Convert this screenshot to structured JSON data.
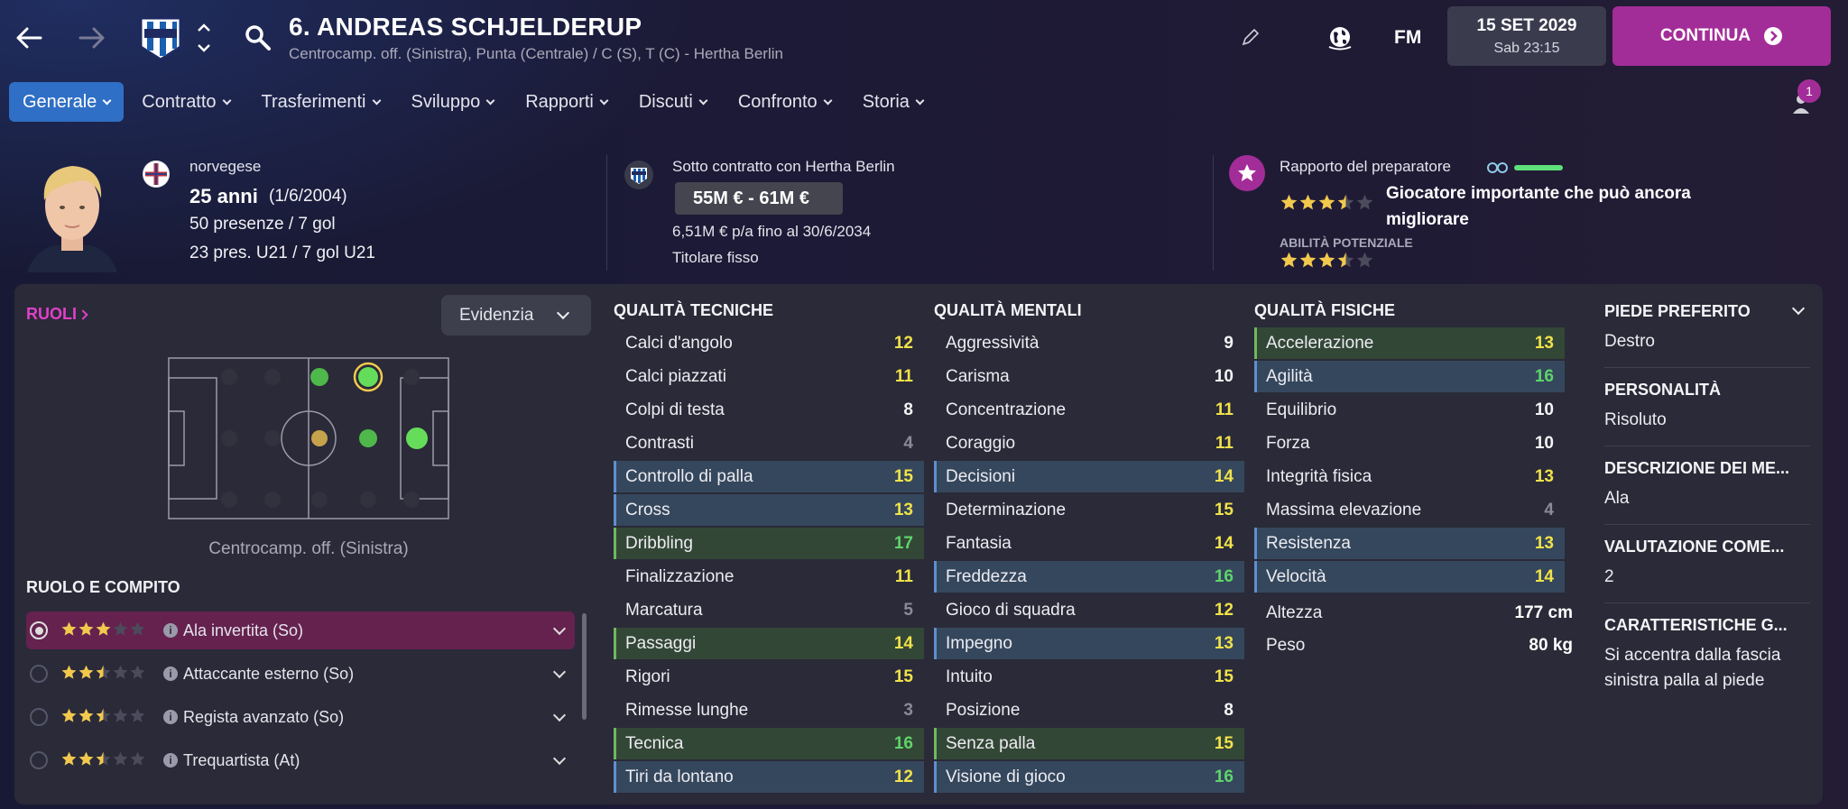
{
  "header": {
    "title": "6. ANDREAS SCHJELDERUP",
    "subtitle": "Centrocamp. off. (Sinistra), Punta (Centrale) / C (S), T (C) - Hertha Berlin",
    "date": "15 SET 2029",
    "time": "Sab 23:15",
    "continue_label": "CONTINUA",
    "fm_label": "FM"
  },
  "tabs": [
    "Generale",
    "Contratto",
    "Trasferimenti",
    "Sviluppo",
    "Rapporti",
    "Discuti",
    "Confronto",
    "Storia"
  ],
  "notification_count": "1",
  "player": {
    "nationality": "norvegese",
    "age": "25 anni",
    "birthdate": "(1/6/2004)",
    "apps": "50 presenze / 7 gol",
    "u21": "23 pres. U21 / 7 gol U21"
  },
  "contract": {
    "club": "Sotto contratto con Hertha Berlin",
    "value": "55M € - 61M €",
    "wage": "6,51M € p/a fino al 30/6/2034",
    "status": "Titolare fisso"
  },
  "coach_report": {
    "label": "Rapporto del preparatore",
    "summary_line1": "Giocatore importante che può ancora",
    "summary_line2": "migliorare",
    "potential_label": "ABILITÀ POTENZIALE",
    "current_stars": 3.5,
    "potential_stars": 3.5
  },
  "roles": {
    "title": "RUOLI",
    "highlight_button": "Evidenzia",
    "position_label": "Centrocamp. off. (Sinistra)",
    "role_duty_title": "RUOLO E COMPITO",
    "items": [
      {
        "label": "Ala invertita (So)",
        "stars": 3
      },
      {
        "label": "Attaccante esterno (So)",
        "stars": 2.5
      },
      {
        "label": "Regista avanzato (So)",
        "stars": 2.5
      },
      {
        "label": "Trequartista (At)",
        "stars": 2.5
      }
    ]
  },
  "technical": {
    "title": "QUALITÀ TECNICHE",
    "items": [
      {
        "name": "Calci d'angolo",
        "value": "12"
      },
      {
        "name": "Calci piazzati",
        "value": "11"
      },
      {
        "name": "Colpi di testa",
        "value": "8"
      },
      {
        "name": "Contrasti",
        "value": "4"
      },
      {
        "name": "Controllo di palla",
        "value": "15"
      },
      {
        "name": "Cross",
        "value": "13"
      },
      {
        "name": "Dribbling",
        "value": "17"
      },
      {
        "name": "Finalizzazione",
        "value": "11"
      },
      {
        "name": "Marcatura",
        "value": "5"
      },
      {
        "name": "Passaggi",
        "value": "14"
      },
      {
        "name": "Rigori",
        "value": "15"
      },
      {
        "name": "Rimesse lunghe",
        "value": "3"
      },
      {
        "name": "Tecnica",
        "value": "16"
      },
      {
        "name": "Tiri da lontano",
        "value": "12"
      }
    ]
  },
  "mental": {
    "title": "QUALITÀ MENTALI",
    "items": [
      {
        "name": "Aggressività",
        "value": "9"
      },
      {
        "name": "Carisma",
        "value": "10"
      },
      {
        "name": "Concentrazione",
        "value": "11"
      },
      {
        "name": "Coraggio",
        "value": "11"
      },
      {
        "name": "Decisioni",
        "value": "14"
      },
      {
        "name": "Determinazione",
        "value": "15"
      },
      {
        "name": "Fantasia",
        "value": "14"
      },
      {
        "name": "Freddezza",
        "value": "16"
      },
      {
        "name": "Gioco di squadra",
        "value": "12"
      },
      {
        "name": "Impegno",
        "value": "13"
      },
      {
        "name": "Intuito",
        "value": "15"
      },
      {
        "name": "Posizione",
        "value": "8"
      },
      {
        "name": "Senza palla",
        "value": "15"
      },
      {
        "name": "Visione di gioco",
        "value": "16"
      }
    ]
  },
  "physical": {
    "title": "QUALITÀ FISICHE",
    "items": [
      {
        "name": "Accelerazione",
        "value": "13"
      },
      {
        "name": "Agilità",
        "value": "16"
      },
      {
        "name": "Equilibrio",
        "value": "10"
      },
      {
        "name": "Forza",
        "value": "10"
      },
      {
        "name": "Integrità fisica",
        "value": "13"
      },
      {
        "name": "Massima elevazione",
        "value": "4"
      },
      {
        "name": "Resistenza",
        "value": "13"
      },
      {
        "name": "Velocità",
        "value": "14"
      }
    ],
    "height_label": "Altezza",
    "height": "177 cm",
    "weight_label": "Peso",
    "weight": "80 kg"
  },
  "details": {
    "foot_label": "PIEDE PREFERITO",
    "foot": "Destro",
    "personality_label": "PERSONALITÀ",
    "personality": "Risoluto",
    "media_label": "DESCRIZIONE DEI ME...",
    "media": "Ala",
    "rating_label": "VALUTAZIONE COME...",
    "rating": "2",
    "traits_label": "CARATTERISTICHE G...",
    "traits": "Si accentra dalla fascia sinistra palla al piede"
  },
  "colors": {
    "accent": "#a32d98",
    "tab_active": "#2f6fc5",
    "good": "#5ed46a",
    "ok": "#f0e24a"
  }
}
